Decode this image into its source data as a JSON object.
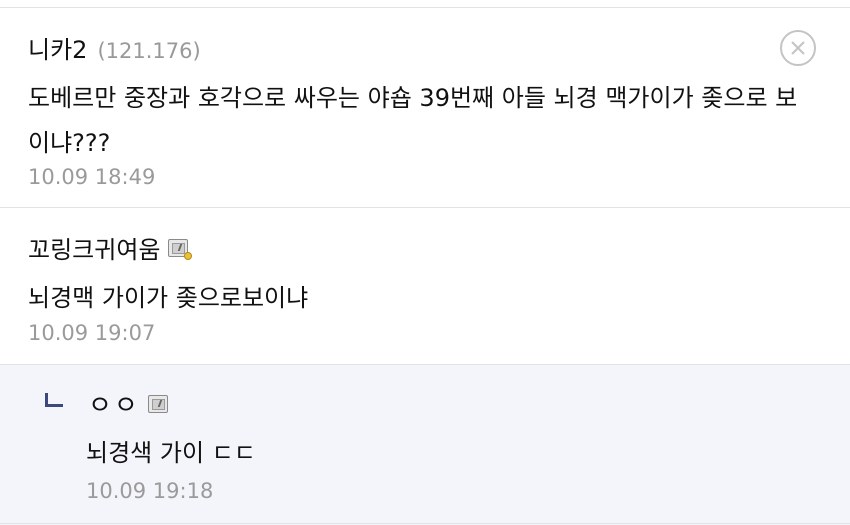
{
  "comments": [
    {
      "nickname": "니카2",
      "ip": "(121.176)",
      "text": "도베르만 중장과 호각으로 싸우는 야숍 39번째 아들 뇌경 맥가이가 좆으로 보이냐???",
      "time": "10.09 18:49",
      "has_delete_button": true
    },
    {
      "nickname": "꼬링크귀여움",
      "badge": "gallery-fixed-nick-icon",
      "text": "뇌경맥 가이가 좆으로보이냐",
      "time": "10.09 19:07"
    }
  ],
  "reply": {
    "nickname": "ㅇㅇ",
    "badge": "gallery-nick-icon",
    "text": "뇌경색 가이 ㄷㄷ",
    "time": "10.09 19:18"
  },
  "colors": {
    "reply_background": "#f3f5fa",
    "reply_arrow": "#3b4a7a",
    "timestamp": "#9a9a9a",
    "divider": "#e3e3e3"
  }
}
